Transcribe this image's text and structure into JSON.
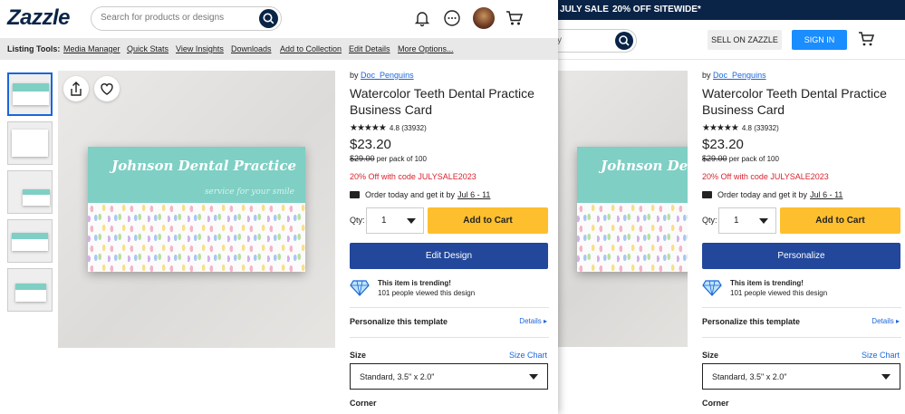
{
  "promo_bar": {
    "part1": "JULY SALE",
    "part2": "20% OFF SITEWIDE*"
  },
  "colors": {
    "navy": "#0a2447",
    "accent_blue": "#1a8dff",
    "cta_yellow": "#fdbf2d",
    "edit_blue": "#22479b",
    "sale_red": "#d9232e",
    "mint": "#7fcfc4"
  },
  "header": {
    "logo": "Zazzle",
    "search_placeholder": "Search for products or designs",
    "bg_search_placeholder": "y",
    "sell_button": "SELL ON ZAZZLE",
    "sign_in_button": "SIGN IN",
    "icons": [
      "bell-icon",
      "chat-icon",
      "avatar",
      "cart-icon"
    ]
  },
  "listing_tools": {
    "label": "Listing Tools:",
    "links": [
      "Media Manager",
      "Quick Stats",
      "View Insights",
      "Downloads",
      "Add to Collection",
      "Edit Details",
      "More Options..."
    ]
  },
  "product": {
    "by_prefix": "by",
    "designer": "Doc_Penguins",
    "title": "Watercolor Teeth Dental Practice Business Card",
    "rating_value": "4.8",
    "rating_count": "(33932)",
    "stars": 4.8,
    "price": "$23.20",
    "original_price": "$29.00",
    "per_pack": "per pack of 100",
    "promo_code_text": "20% Off with code JULYSALE2023",
    "ship_text": "Order today and get it by",
    "ship_date": "Jul 6 - 11",
    "qty_label": "Qty:",
    "qty_value": "1",
    "add_to_cart": "Add to Cart",
    "edit_design": "Edit Design",
    "personalize": "Personalize",
    "trending_title": "This item is trending!",
    "trending_sub": "101 people viewed this design",
    "personalize_template": "Personalize this template",
    "details": "Details",
    "size_label": "Size",
    "size_chart": "Size Chart",
    "size_value": "Standard, 3.5\" x 2.0\"",
    "corner_label": "Corner"
  },
  "card_preview": {
    "practice_name": "Johnson Dental Practice",
    "tagline": "service for your smile"
  },
  "thumbnails": [
    "card-front",
    "card-back",
    "card-plant",
    "card-scene",
    "card-desk"
  ]
}
